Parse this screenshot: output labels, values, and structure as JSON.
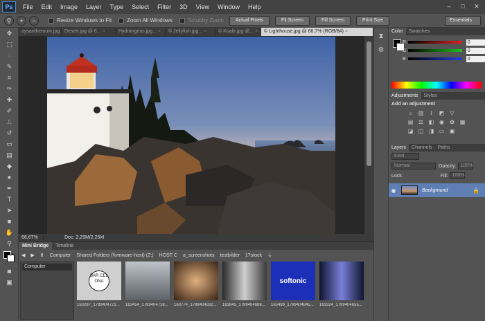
{
  "app": {
    "logo": "Ps"
  },
  "menubar": {
    "items": [
      "File",
      "Edit",
      "Image",
      "Layer",
      "Type",
      "Select",
      "Filter",
      "3D",
      "View",
      "Window",
      "Help"
    ]
  },
  "window_controls": {
    "minimize": "–",
    "maximize": "□",
    "close": "✕"
  },
  "optionsbar": {
    "zoom_in_icon": "zoom-in-icon",
    "zoom_out_icon": "zoom-out-icon",
    "resize_windows": "Resize Windows to Fit",
    "zoom_all": "Zoom All Windows",
    "scrubby_zoom": "Scrubby Zoom",
    "actual_pixels": "Actual Pixels",
    "fit_screen": "Fit Screen",
    "fill_screen": "Fill Screen",
    "print_size": "Print Size",
    "workspace": "Essentials"
  },
  "tabs": [
    {
      "label": "aysanthemum.jpg",
      "active": false
    },
    {
      "label": "Desert.jpg @ 6...",
      "active": false
    },
    {
      "label": "Hydrangeas.jpg...",
      "active": false
    },
    {
      "label": "© Jellyfish.jpg...",
      "active": false
    },
    {
      "label": "© Koala.jpg @...",
      "active": false
    },
    {
      "label": "© Lighthouse.jpg @ 66,7% (RGB/8#)",
      "active": true
    }
  ],
  "tab_close": "×",
  "statusbar": {
    "zoom": "66,67%",
    "doc": "Doc: 2,25M/2,25M"
  },
  "bridge": {
    "tabs": [
      "Mini Bridge",
      "Timeline"
    ],
    "path": [
      "Computer",
      "Shared Folders (\\\\vmware-host) (Z:)",
      "HOST C",
      "a_screenshots",
      "testbilder",
      "1?stock"
    ],
    "location_select": "Computer",
    "thumbnails": [
      {
        "label": "163287_1799404721...",
        "color": "#cfcfcf",
        "kind": "barcelona"
      },
      {
        "label": "163454_1799404718...",
        "color": "#8a8f95",
        "kind": "office"
      },
      {
        "label": "163774_1799404832...",
        "color": "#5a3a24",
        "kind": "hall"
      },
      {
        "label": "163845_1799404688...",
        "color": "#6e6e6e",
        "kind": "room"
      },
      {
        "label": "165499_1799404845...",
        "color": "#1b2fb8",
        "kind": "softonic"
      },
      {
        "label": "163324_1799404655...",
        "color": "#1a1f3a",
        "kind": "corridor"
      }
    ],
    "softonic_text": "softonic",
    "barcelona_text": "BAR CEL ONA"
  },
  "panels": {
    "color_tabs": [
      "Color",
      "Swatches"
    ],
    "rgb": [
      {
        "label": "R",
        "value": "0",
        "color": "#e02020"
      },
      {
        "label": "G",
        "value": "0",
        "color": "#20c020"
      },
      {
        "label": "B",
        "value": "0",
        "color": "#2040e0"
      }
    ],
    "adjust_tabs": [
      "Adjustments",
      "Styles"
    ],
    "add_adjustment": "Add an adjustment",
    "layers_tabs": [
      "Layers",
      "Channels",
      "Paths"
    ],
    "kind": "Kind",
    "blend_mode": "Normal",
    "opacity_label": "Opacity:",
    "opacity_value": "100%",
    "lock_label": "Lock:",
    "fill_label": "Fill:",
    "fill_value": "100%",
    "layer_name": "Background"
  }
}
